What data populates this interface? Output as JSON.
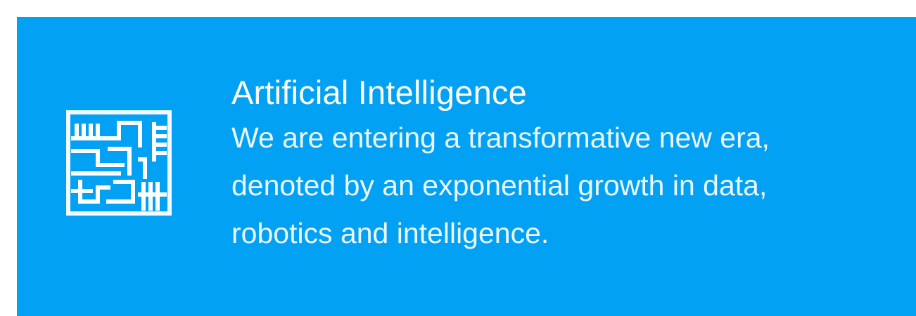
{
  "card": {
    "background_color": "#03A1F3",
    "text_color": "#FFFFFF",
    "icon": "circuit-board-icon",
    "title": "Artificial Intelligence",
    "description_lines": [
      "We are entering a transformative new era,",
      "denoted by an exponential growth in data,",
      "robotics and intelligence."
    ]
  }
}
